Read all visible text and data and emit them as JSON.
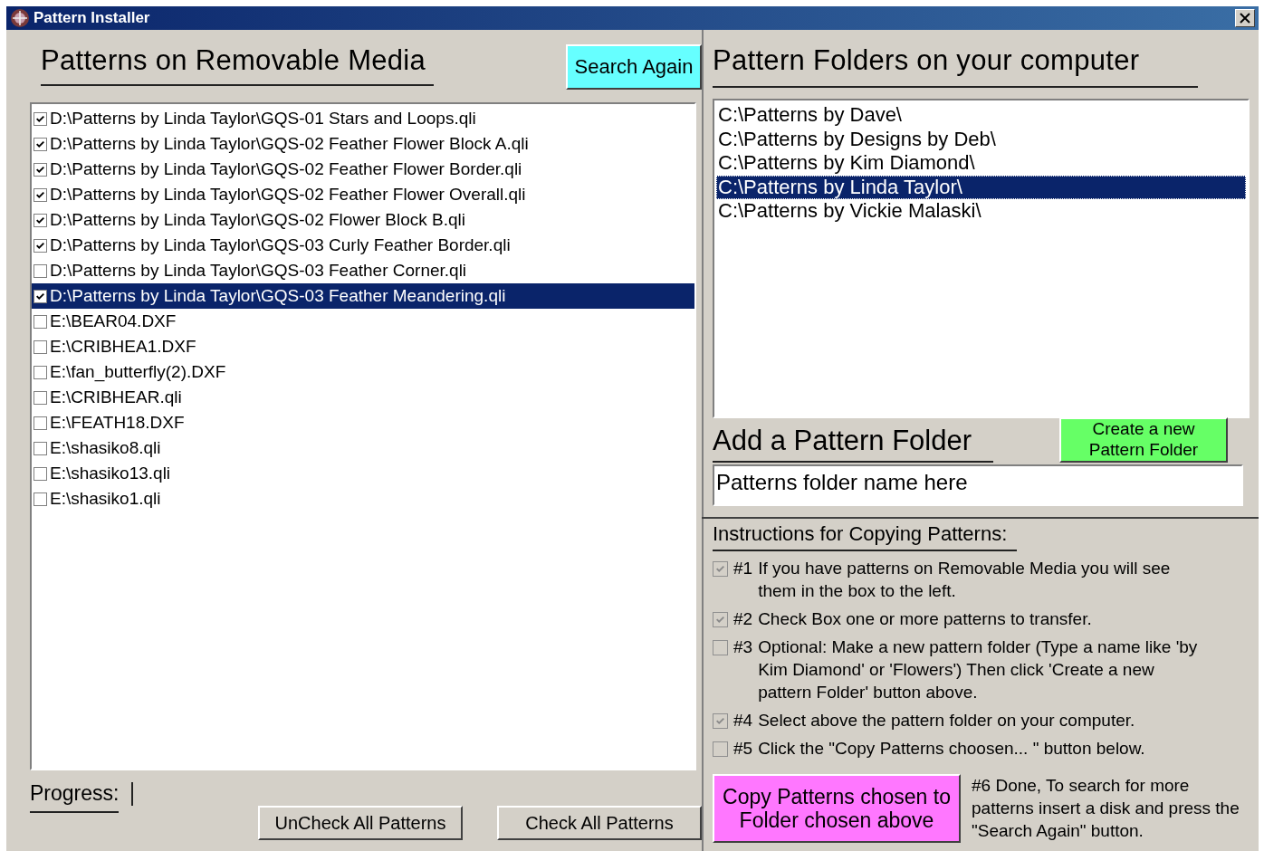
{
  "window": {
    "title": "Pattern Installer"
  },
  "removable": {
    "title": "Patterns on Removable Media",
    "search_button": "Search Again",
    "files": [
      {
        "path": "D:\\Patterns by Linda Taylor\\GQS-01 Stars and Loops.qli",
        "checked": true,
        "selected": false
      },
      {
        "path": "D:\\Patterns by Linda Taylor\\GQS-02 Feather Flower Block A.qli",
        "checked": true,
        "selected": false
      },
      {
        "path": "D:\\Patterns by Linda Taylor\\GQS-02 Feather Flower Border.qli",
        "checked": true,
        "selected": false
      },
      {
        "path": "D:\\Patterns by Linda Taylor\\GQS-02 Feather Flower Overall.qli",
        "checked": true,
        "selected": false
      },
      {
        "path": "D:\\Patterns by Linda Taylor\\GQS-02 Flower Block B.qli",
        "checked": true,
        "selected": false
      },
      {
        "path": "D:\\Patterns by Linda Taylor\\GQS-03 Curly Feather Border.qli",
        "checked": true,
        "selected": false
      },
      {
        "path": "D:\\Patterns by Linda Taylor\\GQS-03 Feather Corner.qli",
        "checked": false,
        "selected": false
      },
      {
        "path": "D:\\Patterns by Linda Taylor\\GQS-03 Feather Meandering.qli",
        "checked": true,
        "selected": true
      },
      {
        "path": "E:\\BEAR04.DXF",
        "checked": false,
        "selected": false
      },
      {
        "path": "E:\\CRIBHEA1.DXF",
        "checked": false,
        "selected": false
      },
      {
        "path": "E:\\fan_butterfly(2).DXF",
        "checked": false,
        "selected": false
      },
      {
        "path": "E:\\CRIBHEAR.qli",
        "checked": false,
        "selected": false
      },
      {
        "path": "E:\\FEATH18.DXF",
        "checked": false,
        "selected": false
      },
      {
        "path": "E:\\shasiko8.qli",
        "checked": false,
        "selected": false
      },
      {
        "path": "E:\\shasiko13.qli",
        "checked": false,
        "selected": false
      },
      {
        "path": "E:\\shasiko1.qli",
        "checked": false,
        "selected": false
      }
    ],
    "progress_label": "Progress:",
    "buttons": [
      "UnCheck All Patterns",
      "Check All Patterns"
    ]
  },
  "computer": {
    "title": "Pattern Folders on your computer",
    "folders": [
      {
        "path": "C:\\Patterns by Dave\\",
        "selected": false
      },
      {
        "path": "C:\\Patterns by Designs by Deb\\",
        "selected": false
      },
      {
        "path": "C:\\Patterns by Kim Diamond\\",
        "selected": false
      },
      {
        "path": "C:\\Patterns by Linda Taylor\\",
        "selected": true
      },
      {
        "path": "C:\\Patterns by Vickie Malaski\\",
        "selected": false
      }
    ],
    "add_title": "Add a Pattern Folder",
    "create_button": "Create a new Pattern Folder",
    "folder_name": "Patterns folder name here"
  },
  "instructions": {
    "title": "Instructions for Copying Patterns:",
    "steps": [
      {
        "number": "#1",
        "text": "If you have patterns on Removable Media you will see them in the box to the left.",
        "checked": true
      },
      {
        "number": "#2",
        "text": "Check Box one or more patterns to transfer.",
        "checked": true
      },
      {
        "number": "#3",
        "text": "Optional: Make a new pattern folder (Type a name like 'by Kim Diamond' or 'Flowers') Then click 'Create a new pattern Folder' button above.",
        "checked": false
      },
      {
        "number": "#4",
        "text": "Select above the pattern folder on your computer.",
        "checked": true
      },
      {
        "number": "#5",
        "text": "Click the \"Copy Patterns choosen... \" button below.",
        "checked": false
      }
    ],
    "copy_button": "Copy Patterns chosen to Folder chosen above",
    "done_text": "#6 Done, To search for more patterns insert a disk and press the \"Search Again\" button."
  }
}
